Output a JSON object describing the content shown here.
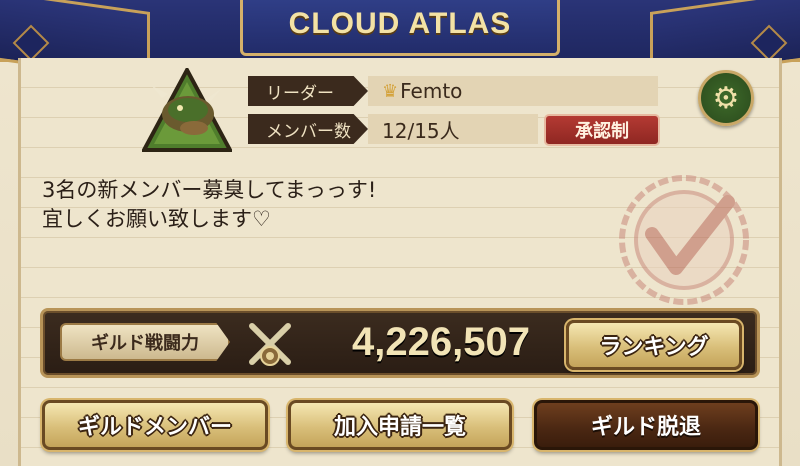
{
  "guild": {
    "name": "CLOUD ATLAS",
    "leader_label": "リーダー",
    "leader_name": "Femto",
    "members_label": "メンバー数",
    "members_value": "12/15人",
    "approval_badge": "承認制",
    "description_lines": [
      "3名の新メンバー募臭してまっっす!",
      "宜しくお願い致します♡"
    ]
  },
  "power": {
    "label": "ギルド戦闘力",
    "value": "4,226,507"
  },
  "buttons": {
    "ranking": "ランキング",
    "guild_members": "ギルドメンバー",
    "join_requests": "加入申請一覧",
    "leave_guild": "ギルド脱退"
  },
  "colors": {
    "banner": "#222c6a",
    "gold_trim": "#c8a15a",
    "parchment": "#eee5cd",
    "approval_red": "#a3302a",
    "gear_green": "#3e6a2a"
  },
  "icons": {
    "emblem": "dragon-emblem-icon",
    "crown": "crown-icon",
    "settings": "gear-icon",
    "power": "crossed-swords-icon",
    "stamp": "approved-stamp-icon"
  }
}
